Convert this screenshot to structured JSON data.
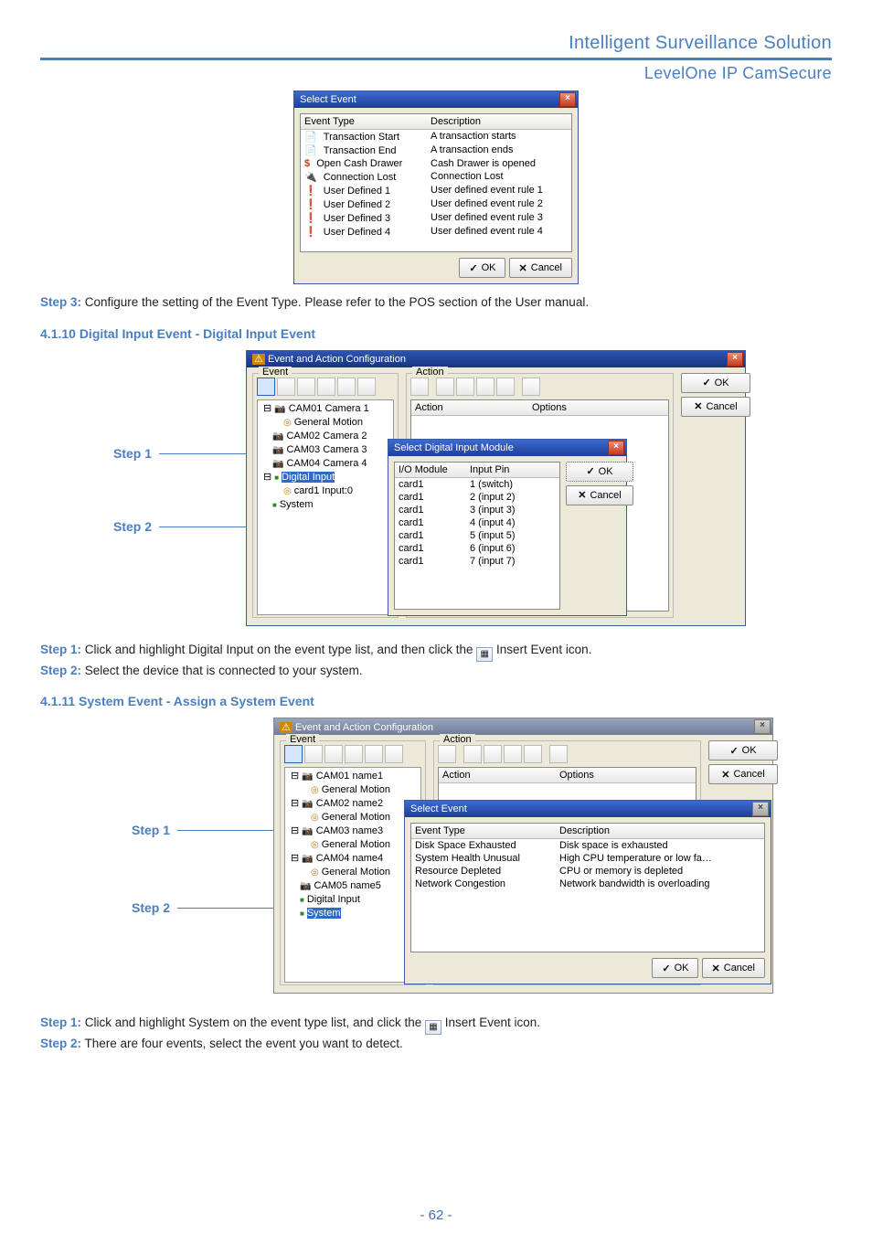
{
  "header": {
    "line1": "Intelligent Surveillance Solution",
    "line2": "LevelOne IP CamSecure"
  },
  "dlg1": {
    "title": "Select Event",
    "cols": {
      "c1": "Event Type",
      "c2": "Description"
    },
    "rows": [
      {
        "type": "Transaction Start",
        "desc": "A transaction starts"
      },
      {
        "type": "Transaction End",
        "desc": "A transaction ends"
      },
      {
        "type": "Open Cash Drawer",
        "desc": "Cash Drawer is opened"
      },
      {
        "type": "Connection Lost",
        "desc": "Connection Lost"
      },
      {
        "type": "User Defined 1",
        "desc": "User defined event rule 1"
      },
      {
        "type": "User Defined 2",
        "desc": "User defined event rule 2"
      },
      {
        "type": "User Defined 3",
        "desc": "User defined event rule 3"
      },
      {
        "type": "User Defined 4",
        "desc": "User defined event rule 4"
      }
    ],
    "ok": "OK",
    "cancel": "Cancel"
  },
  "t_step3_lbl": "Step 3:",
  "t_step3_txt": " Configure the setting of the Event Type. Please refer to the POS section of the User manual.",
  "sec4110": "4.1.10 Digital Input Event - Digital Input Event",
  "eventcfg": {
    "title": "Event and Action Configuration",
    "eventLegend": "Event",
    "actionLegend": "Action",
    "actionCol": "Action",
    "optionsCol": "Options",
    "ok": "OK",
    "cancel": "Cancel",
    "tree": [
      "CAM01 Camera 1",
      "General Motion",
      "CAM02 Camera 2",
      "CAM03 Camera 3",
      "CAM04 Camera 4",
      "Digital Input",
      "card1 Input:0",
      "System"
    ]
  },
  "selectDI": {
    "title": "Select Digital Input Module",
    "c1": "I/O Module",
    "c2": "Input Pin",
    "rows": [
      {
        "m": "card1",
        "p": "1 (switch)"
      },
      {
        "m": "card1",
        "p": "2 (input 2)"
      },
      {
        "m": "card1",
        "p": "3 (input 3)"
      },
      {
        "m": "card1",
        "p": "4 (input 4)"
      },
      {
        "m": "card1",
        "p": "5 (input 5)"
      },
      {
        "m": "card1",
        "p": "6 (input 6)"
      },
      {
        "m": "card1",
        "p": "7 (input 7)"
      }
    ],
    "ok": "OK",
    "cancel": "Cancel"
  },
  "callouts": {
    "s1": "Step 1",
    "s2": "Step 2"
  },
  "t4110": {
    "s1lbl": "Step 1:",
    "s1txt": " Click and highlight Digital Input on the event type list, and then click the ",
    "s1txt2": " Insert Event icon.",
    "s2lbl": "Step 2:",
    "s2txt": " Select the device that is connected to your system."
  },
  "sec4111": "4.1.11 System Event - Assign a System Event",
  "eventcfg2": {
    "title": "Event and Action Configuration",
    "eventLegend": "Event",
    "actionLegend": "Action",
    "actionCol": "Action",
    "optionsCol": "Options",
    "ok": "OK",
    "cancel": "Cancel",
    "tree": [
      "CAM01 name1",
      "General Motion",
      "CAM02 name2",
      "General Motion",
      "CAM03 name3",
      "General Motion",
      "CAM04 name4",
      "General Motion",
      "CAM05 name5",
      "Digital Input",
      "System"
    ]
  },
  "selectSys": {
    "title": "Select Event",
    "c1": "Event Type",
    "c2": "Description",
    "rows": [
      {
        "t": "Disk Space Exhausted",
        "d": "Disk space is exhausted"
      },
      {
        "t": "System Health Unusual",
        "d": "High CPU temperature or low fa…"
      },
      {
        "t": "Resource Depleted",
        "d": "CPU or memory is depleted"
      },
      {
        "t": "Network Congestion",
        "d": "Network bandwidth is overloading"
      }
    ],
    "ok": "OK",
    "cancel": "Cancel"
  },
  "t4111": {
    "s1lbl": "Step 1:",
    "s1txt": " Click and highlight System on the event type list, and click the ",
    "s1txt2": " Insert Event icon.",
    "s2lbl": "Step 2:",
    "s2txt": " There are four events, select the event you want to detect."
  },
  "pageNumber": "- 62 -"
}
